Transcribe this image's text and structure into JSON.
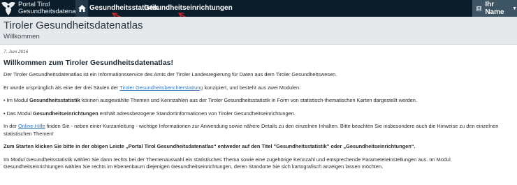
{
  "navbar": {
    "brand_line1": "Portal Tirol",
    "brand_line2": "Gesundheitsdatenatlas",
    "home_icon": "home-icon",
    "nav_stat": "Gesundheitsstatistik",
    "nav_einr": "Gesundheitseinrichtungen",
    "user_label": "Ihr Name",
    "colors": {
      "bar": "#0b1d2a",
      "home_bg": "#24394a",
      "user_bg": "#3e5566",
      "arrow": "#c0282d"
    }
  },
  "header": {
    "title": "Tiroler Gesundheitsdatenatlas",
    "subtitle": "Willkommen"
  },
  "content": {
    "date": "7. Juni 2016",
    "welcome": "Willkommen zum Tiroler Gesundheitsdatenatlas!",
    "p1": "Der Tiroler Gesundheitsdatenatlas ist ein Informationsservice des Amts der Tiroler Landesregierung für Daten aus dem Tiroler Gesundheitswesen.",
    "p2_before": "Er wurde ursprünglich als eine der drei Säulen der ",
    "p2_link": "Tiroler Gesundheitsberichterstattung",
    "p2_after": " konzipiert, und besteht aus zwei Modulen:",
    "p3_before": "• Im Modul ",
    "p3_bold": "Gesundheitsstatistik",
    "p3_after": " können ausgewählte Themen und Kennzahlen aus der Tiroler Gesundheitsstatistik in Form von statistisch-thematischen Karten dargestellt werden.",
    "p4_before": "• Das Modul ",
    "p4_bold": "Gesundheitseinrichtungen",
    "p4_after": " enthält adressbezogene Standortinformationen von Tiroler Gesundheitseinrichtungen.",
    "p5_before": "In der ",
    "p5_link": "Online-Hilfe",
    "p5_after": " finden Sie - neben einer Kurzanleitung - wichtige Informationen zur Anwendung sowie nähere Details zu den einzelnen Inhalten. Bitte beachten Sie insbesondere auch die Hinweise zu den einzelnen statistischen Themen!",
    "p6": "Zum Starten klicken Sie bitte in der obigen Leiste „Portal Tirol Gesundheitsdatenatlas“ entweder auf den Titel \"Gesundheitsstatistik\" oder „Gesundheitseinrichtungen“.",
    "p7": "Im Modul Gesundheitsstatistik wählen Sie dann rechts bei der Themenauswahl ein statistisches Thema sowie eine zugehörige Kennzahl und entsprechende Parametereinstellungen aus. Im Modul Gesundheitseinrichtungen wählen Sie rechts im Ebenenbaum diejenigen Gesundheitseinrichtungen, deren Standorte Sie sich kartografisch anzeigen lassen möchten."
  }
}
